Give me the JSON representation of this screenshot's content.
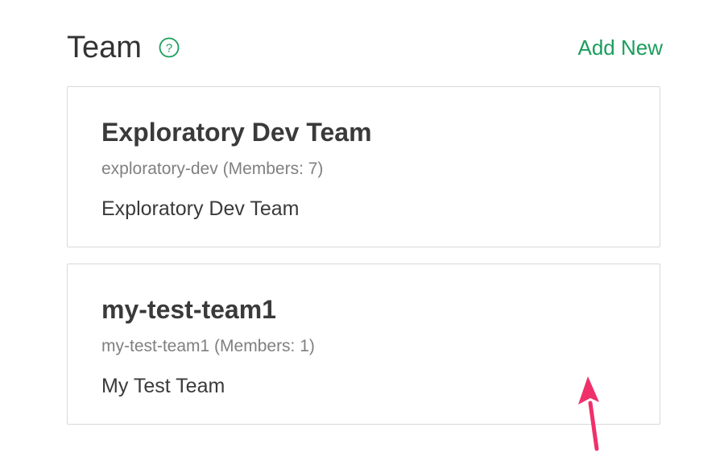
{
  "header": {
    "title": "Team",
    "add_new_label": "Add New",
    "help_icon": "question-circle-icon"
  },
  "teams": [
    {
      "name": "Exploratory Dev Team",
      "slug": "exploratory-dev",
      "members_text": "(Members: 7)",
      "description": "Exploratory Dev Team"
    },
    {
      "name": "my-test-team1",
      "slug": "my-test-team1",
      "members_text": "(Members: 1)",
      "description": "My Test Team"
    }
  ],
  "annotation": {
    "icon": "arrow-annotation-icon",
    "color": "#f0306a"
  },
  "colors": {
    "accent": "#1a9e5c",
    "text": "#333333",
    "muted": "#808080",
    "border": "#d9d9d9"
  }
}
